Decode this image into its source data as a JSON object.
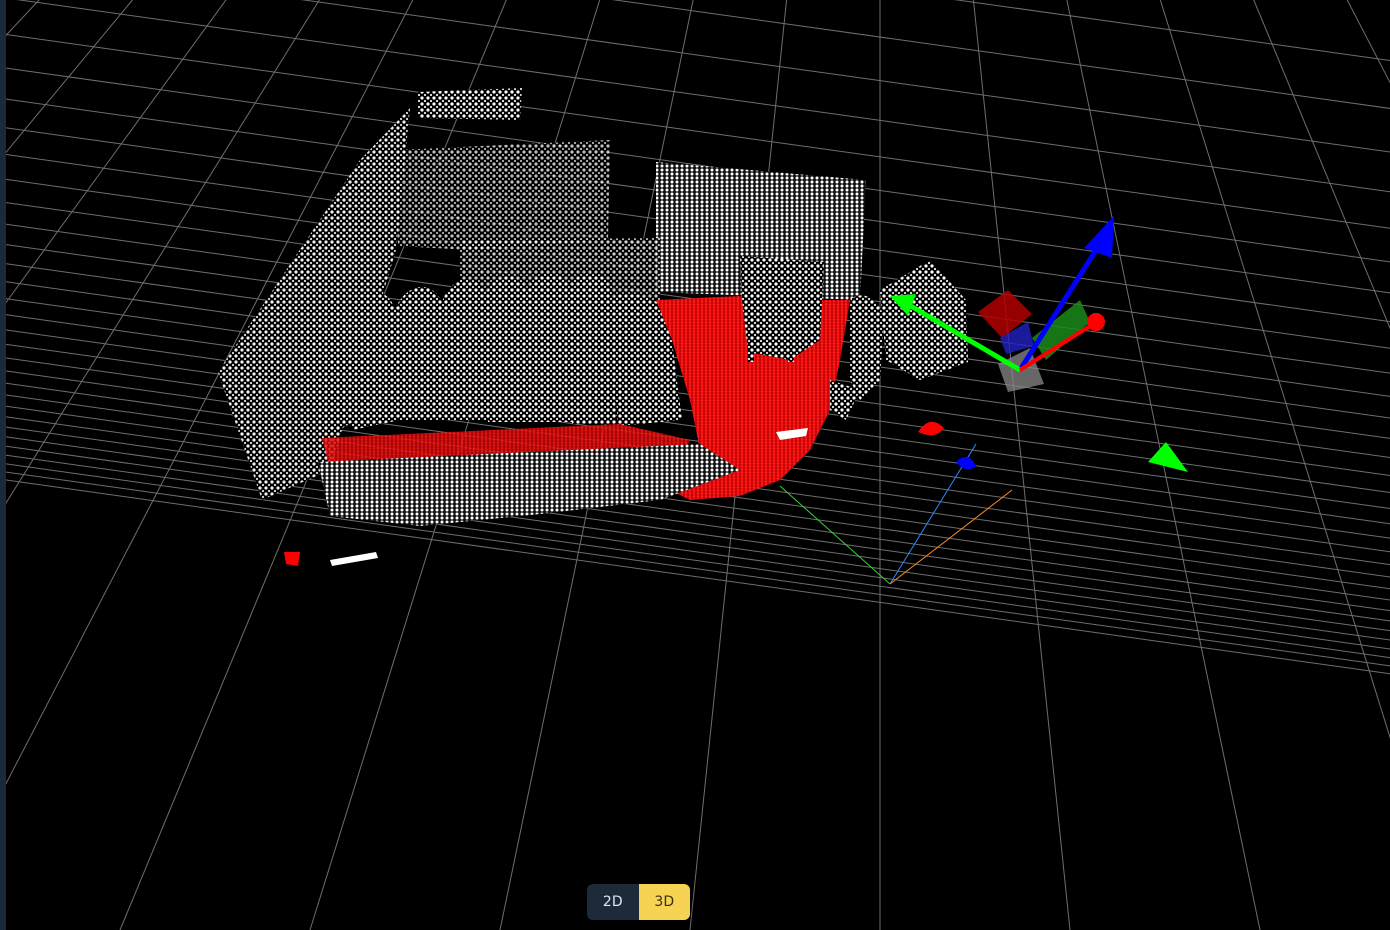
{
  "viewer": {
    "background": "#000000",
    "grid_color": "#6e6e6e",
    "point_colors": {
      "structure": "#ffffff",
      "floor": "#ff0000"
    },
    "axis_colors": {
      "x": "#ff0000",
      "y": "#00ff00",
      "z": "#0000ff"
    }
  },
  "view_toggle": {
    "options": [
      {
        "label": "2D",
        "active": false
      },
      {
        "label": "3D",
        "active": true
      }
    ],
    "active_color": "#f7d354",
    "inactive_color": "#1e2a3a"
  },
  "icons": {
    "translate_gizmo": "transform-gizmo-icon",
    "origin_axes": "origin-axes-icon"
  }
}
